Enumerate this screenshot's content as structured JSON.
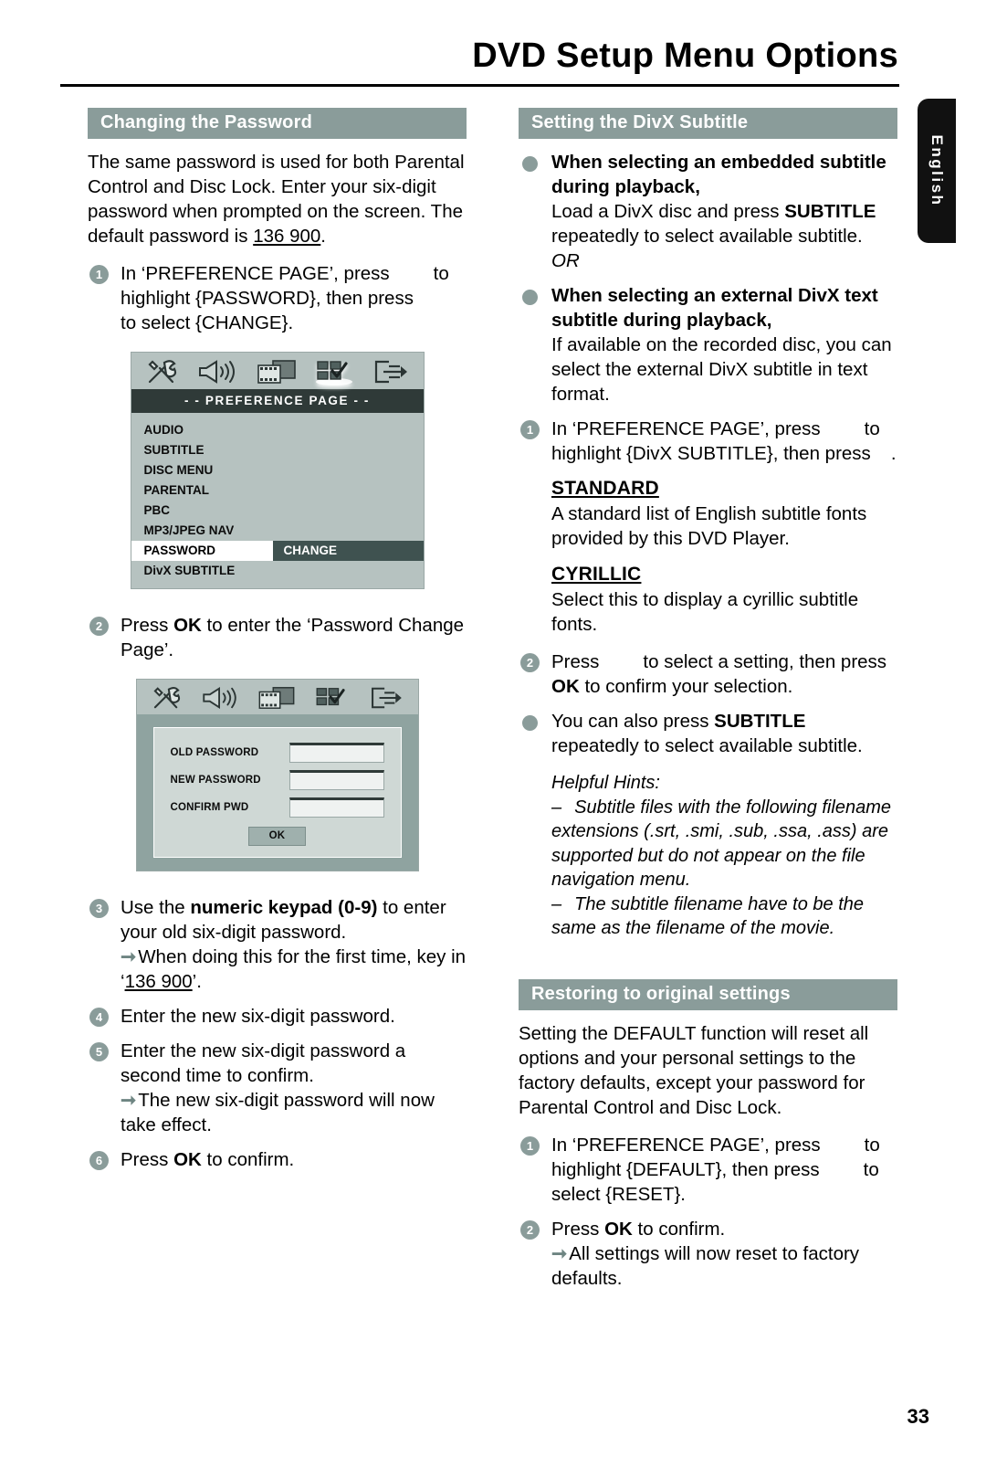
{
  "header": {
    "title": "DVD Setup Menu Options"
  },
  "language_tab": {
    "label": "English"
  },
  "page_number": "33",
  "left_column": {
    "section_title": "Changing the Password",
    "intro_a": "The same password is used for both Parental Control and Disc Lock.  Enter your six-digit password when prompted on the screen. The default password is ",
    "intro_default_password": "136 900",
    "intro_b": ".",
    "step1_a": "In ‘PREFERENCE PAGE’, press",
    "step1_b": "to highlight {PASSWORD}, then press",
    "step1_c": "to select {CHANGE}.",
    "step2_a": "Press ",
    "step2_ok": "OK",
    "step2_b": " to enter the ‘Password Change Page’.",
    "step3_a": "Use the ",
    "step3_keypad": "numeric keypad (0-9)",
    "step3_b": " to enter your old six-digit password.",
    "step3_note_a": "When doing this for the first time, key in ‘",
    "step3_note_pw": "136 900",
    "step3_note_b": "’.",
    "step4": "Enter the new six-digit password.",
    "step5": "Enter the new six-digit password a second time to confirm.",
    "step5_note": "The new six-digit password will now take effect.",
    "step6_a": "Press ",
    "step6_ok": "OK",
    "step6_b": " to confirm."
  },
  "screen_preference": {
    "title": "- -  PREFERENCE  PAGE  - -",
    "icons": [
      "tools-icon",
      "speaker-icon",
      "film-icon",
      "preference-grid-icon",
      "exit-icon"
    ],
    "selected_icon_index": 3,
    "rows": [
      {
        "label": "AUDIO",
        "value": "",
        "selected": false
      },
      {
        "label": "SUBTITLE",
        "value": "",
        "selected": false
      },
      {
        "label": "DISC MENU",
        "value": "",
        "selected": false
      },
      {
        "label": "PARENTAL",
        "value": "",
        "selected": false
      },
      {
        "label": "PBC",
        "value": "",
        "selected": false
      },
      {
        "label": "MP3/JPEG NAV",
        "value": "",
        "selected": false
      },
      {
        "label": "PASSWORD",
        "value": "CHANGE",
        "selected": true
      },
      {
        "label": "DivX SUBTITLE",
        "value": "",
        "selected": false
      }
    ]
  },
  "screen_password": {
    "icons": [
      "tools-icon",
      "speaker-icon",
      "film-icon",
      "preference-grid-icon",
      "exit-icon"
    ],
    "fields": [
      {
        "label": "OLD PASSWORD",
        "value": ""
      },
      {
        "label": "NEW PASSWORD",
        "value": ""
      },
      {
        "label": "CONFIRM PWD",
        "value": ""
      }
    ],
    "ok_label": "OK"
  },
  "right_column": {
    "section_title": "Setting the DivX Subtitle",
    "bullet1_head": "When selecting an embedded subtitle during playback,",
    "bullet1_body_a": "Load a DivX disc and press ",
    "bullet1_body_key": "SUBTITLE",
    "bullet1_body_b": " repeatedly to select available subtitle.",
    "bullet1_or": "OR",
    "bullet2_head": "When selecting an external DivX text subtitle during playback,",
    "bullet2_body": "If available on the recorded disc, you can select the external DivX subtitle in text format.",
    "step1_a": "In ‘PREFERENCE PAGE’, press",
    "step1_b": "to highlight {DivX SUBTITLE}, then press",
    "step1_c": ".",
    "standard_head": "STANDARD",
    "standard_body": "A standard list of English subtitle fonts provided by this DVD Player.",
    "cyrillic_head": "CYRILLIC",
    "cyrillic_body": "Select this to display a cyrillic subtitle fonts.",
    "step2_a": "Press",
    "step2_b": "to select a setting, then press ",
    "step2_ok": "OK",
    "step2_c": " to confirm your selection.",
    "bullet3_a": "You can also press ",
    "bullet3_key": "SUBTITLE",
    "bullet3_b": " repeatedly to select available subtitle.",
    "hints_title": "Helpful Hints:",
    "hint1": "Subtitle files with the following filename extensions (.srt, .smi, .sub, .ssa, .ass) are supported but do not appear on the file navigation menu.",
    "hint2": "The subtitle filename have to be the same as the filename of the movie."
  },
  "restore_section": {
    "section_title": "Restoring to original settings",
    "intro": "Setting the DEFAULT function will reset all options and your personal settings to the factory defaults, except your password for Parental Control and Disc Lock.",
    "step1_a": "In ‘PREFERENCE PAGE’, press",
    "step1_b": "to highlight {DEFAULT}, then press",
    "step1_c": "to select {RESET}.",
    "step2_a": "Press ",
    "step2_ok": "OK",
    "step2_b": " to confirm.",
    "step2_note": "All settings will now reset to factory defaults."
  },
  "numbers": {
    "n1": "1",
    "n2": "2",
    "n3": "3",
    "n4": "4",
    "n5": "5",
    "n6": "6"
  },
  "colors": {
    "band": "#8a9c9a",
    "screen_bg": "#b6c2c0",
    "screen_title_bg": "#2f3a38",
    "selected_value_bg": "#3f5250",
    "tab_bg": "#111111"
  }
}
